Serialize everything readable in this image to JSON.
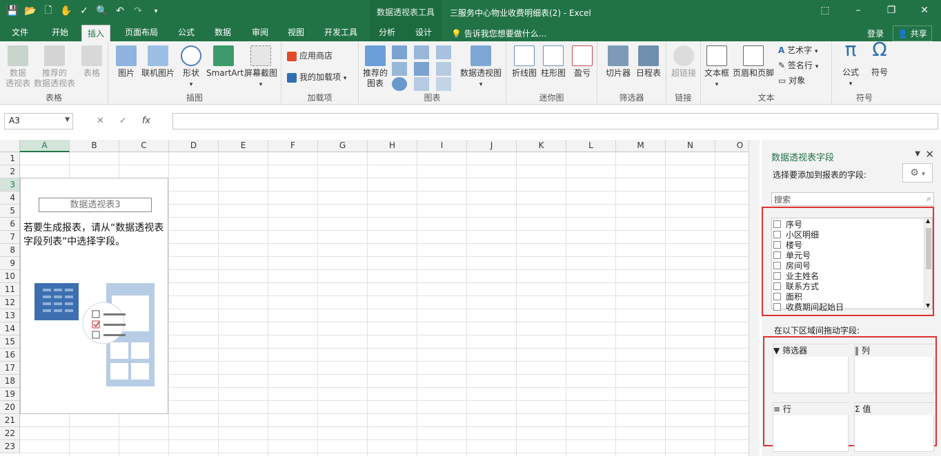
{
  "window": {
    "context_tools": "数据透视表工具",
    "title": "三服务中心物业收费明细表(2) - Excel"
  },
  "tabs": {
    "file": "文件",
    "home": "开始",
    "insert": "插入",
    "layout": "页面布局",
    "formula": "公式",
    "data": "数据",
    "review": "审阅",
    "view": "视图",
    "developer": "开发工具",
    "analyze": "分析",
    "design": "设计"
  },
  "tellme": "告诉我您想要做什么...",
  "account": {
    "login": "登录",
    "share": "共享"
  },
  "ribbon": {
    "tables": {
      "label": "表格",
      "pivot": "数据\n透视表",
      "recommended_pivot": "推荐的\n数据透视表",
      "table": "表格"
    },
    "illustrations": {
      "label": "插图",
      "picture": "图片",
      "online_picture": "联机图片",
      "shapes": "形状",
      "smartart": "SmartArt",
      "screenshot": "屏幕截图"
    },
    "addins": {
      "label": "加载项",
      "store": "应用商店",
      "my_addins": "我的加载项"
    },
    "charts": {
      "label": "图表",
      "recommended": "推荐的\n图表",
      "pivot_chart": "数据透视图"
    },
    "sparklines": {
      "label": "迷你图",
      "line": "折线图",
      "column": "柱形图",
      "winloss": "盈亏"
    },
    "filters": {
      "label": "筛选器",
      "slicer": "切片器",
      "timeline": "日程表"
    },
    "links": {
      "label": "链接",
      "hyperlink": "超链接"
    },
    "text": {
      "label": "文本",
      "textbox": "文本框",
      "header_footer": "页眉和页脚",
      "wordart": "艺术字",
      "signature": "签名行",
      "object": "对象"
    },
    "symbols": {
      "label": "符号",
      "equation": "公式",
      "symbol": "符号"
    }
  },
  "formula_bar": {
    "name_box": "A3",
    "fx": "fx",
    "value": ""
  },
  "sheet": {
    "columns": [
      "A",
      "B",
      "C",
      "D",
      "E",
      "F",
      "G",
      "H",
      "I",
      "J",
      "K",
      "L",
      "M",
      "N",
      "O"
    ],
    "rows": [
      "1",
      "2",
      "3",
      "4",
      "5",
      "6",
      "7",
      "8",
      "9",
      "10",
      "11",
      "12",
      "13",
      "14",
      "15",
      "16",
      "17",
      "18",
      "19",
      "20",
      "21",
      "22",
      "23"
    ],
    "selected_cell": "A3"
  },
  "pivot_placeholder": {
    "name": "数据透视表3",
    "message": "若要生成报表，请从“数据透视表字段列表”中选择字段。"
  },
  "field_pane": {
    "title": "数据透视表字段",
    "subtitle": "选择要添加到报表的字段:",
    "search_placeholder": "搜索",
    "fields": [
      "序号",
      "小区明细",
      "楼号",
      "单元号",
      "房间号",
      "业主姓名",
      "联系方式",
      "面积",
      "收费期间起始日"
    ],
    "drag_label": "在以下区域间拖动字段:",
    "areas": {
      "filter": "筛选器",
      "columns": "列",
      "rows": "行",
      "values": "值"
    }
  }
}
